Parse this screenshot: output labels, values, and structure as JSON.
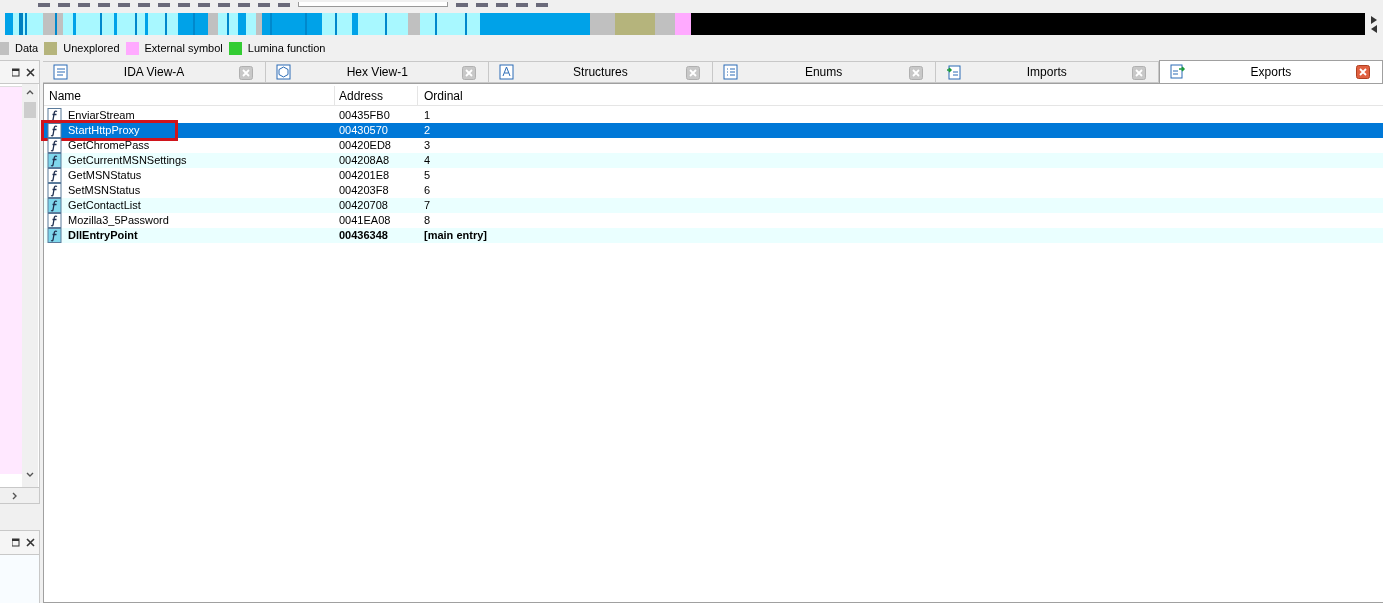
{
  "legend": [
    {
      "label": "Data",
      "color": "#c0c0c0"
    },
    {
      "label": "Unexplored",
      "color": "#b5b47c"
    },
    {
      "label": "External symbol",
      "color": "#ffaaff"
    },
    {
      "label": "Lumina function",
      "color": "#33cc33"
    }
  ],
  "tabs": [
    {
      "label": "IDA View-A",
      "selected": false
    },
    {
      "label": "Hex View-1",
      "selected": false
    },
    {
      "label": "Structures",
      "selected": false
    },
    {
      "label": "Enums",
      "selected": false
    },
    {
      "label": "Imports",
      "selected": false
    },
    {
      "label": "Exports",
      "selected": true
    }
  ],
  "table": {
    "columns": [
      "Name",
      "Address",
      "Ordinal"
    ],
    "rows": [
      {
        "kind": "regular",
        "cells": [
          "EnviarStream",
          "00435FB0",
          "1"
        ],
        "selected": false,
        "highlighted": false,
        "bold": false
      },
      {
        "kind": "regular",
        "cells": [
          "StartHttpProxy",
          "00430570",
          "2"
        ],
        "selected": true,
        "highlighted": true,
        "bold": false
      },
      {
        "kind": "regular",
        "cells": [
          "GetChromePass",
          "00420ED8",
          "3"
        ],
        "selected": false,
        "highlighted": false,
        "bold": false
      },
      {
        "kind": "library",
        "cells": [
          "GetCurrentMSNSettings",
          "004208A8",
          "4"
        ],
        "selected": false,
        "highlighted": false,
        "bold": false
      },
      {
        "kind": "regular",
        "cells": [
          "GetMSNStatus",
          "004201E8",
          "5"
        ],
        "selected": false,
        "highlighted": false,
        "bold": false
      },
      {
        "kind": "regular",
        "cells": [
          "SetMSNStatus",
          "004203F8",
          "6"
        ],
        "selected": false,
        "highlighted": false,
        "bold": false
      },
      {
        "kind": "library",
        "cells": [
          "GetContactList",
          "00420708",
          "7"
        ],
        "selected": false,
        "highlighted": false,
        "bold": false
      },
      {
        "kind": "regular",
        "cells": [
          "Mozilla3_5Password",
          "0041EA08",
          "8"
        ],
        "selected": false,
        "highlighted": false,
        "bold": false
      },
      {
        "kind": "library",
        "cells": [
          "DllEntryPoint",
          "00436348",
          "[main entry]"
        ],
        "selected": false,
        "highlighted": false,
        "bold": true
      }
    ]
  }
}
